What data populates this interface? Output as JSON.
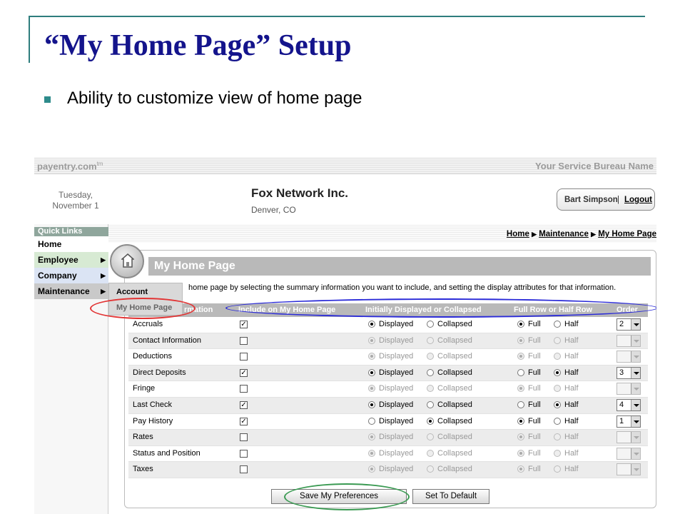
{
  "slide": {
    "title": "“My Home Page” Setup",
    "bullet": "Ability to customize view of home page"
  },
  "app": {
    "brand": "payentry.com",
    "brand_tm": "tm",
    "bureau": "Your Service Bureau Name",
    "date_line1": "Tuesday,",
    "date_line2": "November 1",
    "company_name": "Fox Network Inc.",
    "company_location": "Denver, CO",
    "user": "Bart Simpson",
    "user_sep": "|",
    "logout": "Logout"
  },
  "sidebar": {
    "title": "Quick Links",
    "items": [
      {
        "label": "Home"
      },
      {
        "label": "Employee"
      },
      {
        "label": "Company"
      },
      {
        "label": "Maintenance"
      }
    ],
    "arrow": "▶",
    "flyout": [
      "Account",
      "My Home Page"
    ]
  },
  "breadcrumb": {
    "home": "Home",
    "sep": "▶",
    "maintenance": "Maintenance",
    "current": "My Home Page"
  },
  "panel": {
    "title": "My Home Page",
    "intro": "home page by selecting the summary information you want to include, and setting the display attributes for that information."
  },
  "table": {
    "headers": [
      "rmation",
      "Include on My Home Page",
      "Initially Displayed or Collapsed",
      "Full Row or Half Row",
      "Order"
    ],
    "options": {
      "displayed": "Displayed",
      "collapsed": "Collapsed",
      "full": "Full",
      "half": "Half"
    },
    "rows": [
      {
        "name": "Accruals",
        "include": true,
        "state": "Displayed",
        "width": "Full",
        "order": "2"
      },
      {
        "name": "Contact Information",
        "include": false,
        "state": "Displayed",
        "width": "Full",
        "order": ""
      },
      {
        "name": "Deductions",
        "include": false,
        "state": "Displayed",
        "width": "Full",
        "order": ""
      },
      {
        "name": "Direct Deposits",
        "include": true,
        "state": "Displayed",
        "width": "Half",
        "order": "3"
      },
      {
        "name": "Fringe",
        "include": false,
        "state": "Displayed",
        "width": "Full",
        "order": ""
      },
      {
        "name": "Last Check",
        "include": true,
        "state": "Displayed",
        "width": "Half",
        "order": "4"
      },
      {
        "name": "Pay History",
        "include": true,
        "state": "Collapsed",
        "width": "Full",
        "order": "1"
      },
      {
        "name": "Rates",
        "include": false,
        "state": "Displayed",
        "width": "Full",
        "order": ""
      },
      {
        "name": "Status and Position",
        "include": false,
        "state": "Displayed",
        "width": "Full",
        "order": ""
      },
      {
        "name": "Taxes",
        "include": false,
        "state": "Displayed",
        "width": "Full",
        "order": ""
      }
    ]
  },
  "buttons": {
    "save": "Save My Preferences",
    "default": "Set To Default"
  },
  "colors": {
    "title": "#14148c",
    "accent": "#2e8b8b",
    "red_highlight": "#e23333",
    "blue_highlight": "#2b2bd8",
    "green_highlight": "#3a9a52"
  }
}
